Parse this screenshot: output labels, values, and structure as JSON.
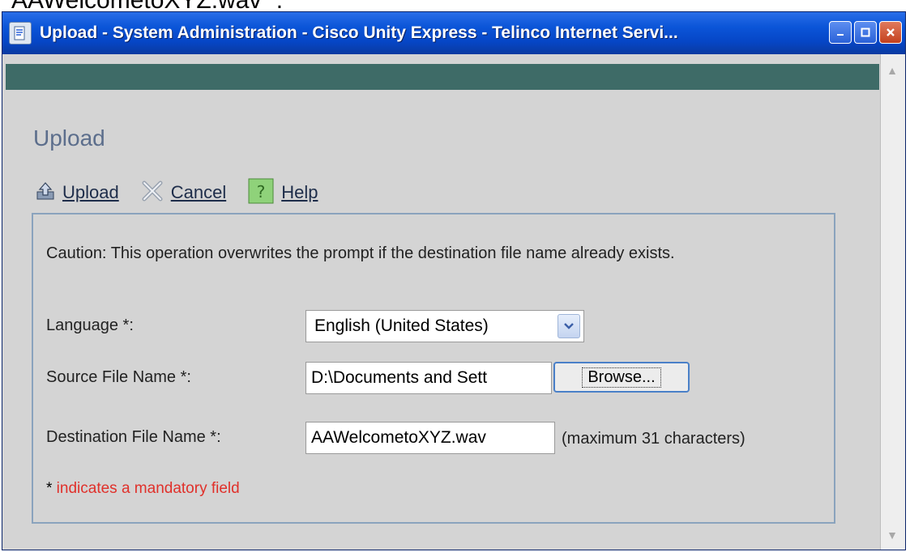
{
  "caption": {
    "text": "AAWelcometoXYZ.wav ”."
  },
  "window": {
    "title": "Upload - System Administration - Cisco Unity Express - Telinco Internet Servi...",
    "controls": {
      "minimize_icon": "minimize-icon",
      "maximize_icon": "maximize-icon",
      "close_icon": "close-icon"
    }
  },
  "page": {
    "title": "Upload"
  },
  "toolbar": {
    "upload_label": "Upload",
    "cancel_label": "Cancel",
    "help_label": "Help"
  },
  "form": {
    "caution": "Caution: This operation overwrites the prompt if the destination file name already exists.",
    "language": {
      "label": "Language *:",
      "selected": "English (United States)"
    },
    "source": {
      "label": "Source File Name *:",
      "value": "D:\\Documents and Sett",
      "browse_label": "Browse..."
    },
    "destination": {
      "label": "Destination File Name *:",
      "value": "AAWelcometoXYZ.wav",
      "hint": "(maximum 31 characters)"
    },
    "mandatory_star": "*",
    "mandatory_note": " indicates a mandatory field"
  },
  "colors": {
    "title_bar": "#0b55d8",
    "header_band": "#3e6b67",
    "page_title": "#5c6e8c",
    "mandatory_note": "#e0302a",
    "panel_border": "#8aa3bd"
  }
}
